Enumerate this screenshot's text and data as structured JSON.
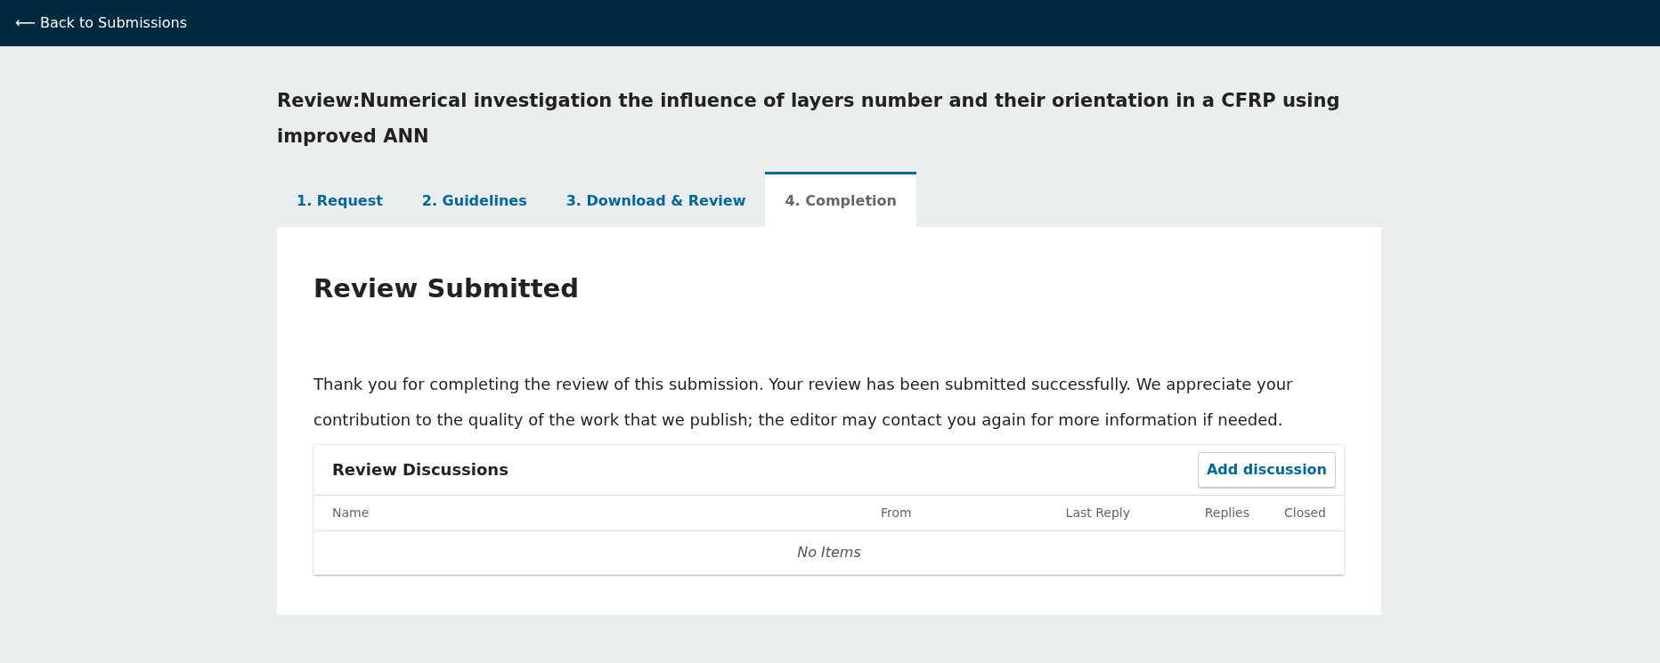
{
  "header": {
    "back_link": "⟵ Back to Submissions"
  },
  "page_title": "Review:Numerical investigation the influence of layers number and their orientation in a CFRP using improved ANN",
  "tabs": [
    {
      "label": "1. Request",
      "selected": false
    },
    {
      "label": "2. Guidelines",
      "selected": false
    },
    {
      "label": "3. Download & Review",
      "selected": false
    },
    {
      "label": "4. Completion",
      "selected": true
    }
  ],
  "panel": {
    "heading": "Review Submitted",
    "message": "Thank you for completing the review of this submission. Your review has been submitted successfully. We appreciate your contribution to the quality of the work that we publish; the editor may contact you again for more information if needed."
  },
  "discussions": {
    "title": "Review Discussions",
    "add_button": "Add discussion",
    "columns": [
      "Name",
      "From",
      "Last Reply",
      "Replies",
      "Closed"
    ],
    "empty_message": "No Items"
  }
}
